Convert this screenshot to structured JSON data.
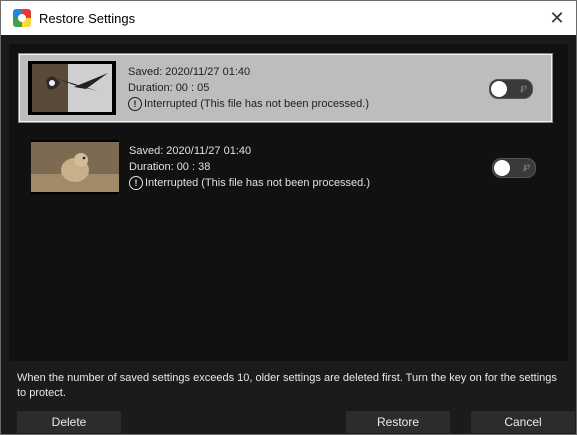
{
  "window": {
    "title": "Restore Settings"
  },
  "items": [
    {
      "saved": "Saved: 2020/11/27 01:40",
      "duration": "Duration: 00 : 05",
      "status": "Interrupted (This file has not been processed.)",
      "thumbnail": "bird-in-flight",
      "protected": false,
      "selected": true
    },
    {
      "saved": "Saved: 2020/11/27 01:40",
      "duration": "Duration: 00 : 38",
      "status": "Interrupted (This file has not been processed.)",
      "thumbnail": "prairie-dog",
      "protected": false,
      "selected": false
    }
  ],
  "key_glyph": "℘",
  "notice": "When the number of saved settings exceeds 10, older settings are deleted first. Turn the key on for the settings to protect.",
  "buttons": {
    "delete": "Delete",
    "restore": "Restore",
    "cancel": "Cancel"
  },
  "icons": {
    "app": "restore-settings-app-icon",
    "close": "close-icon",
    "alert": "alert-circle-icon",
    "key": "key-icon"
  },
  "colors": {
    "background": "#1b1b1b",
    "selected_row": "#bdbdbd",
    "button": "#2c2c2c"
  }
}
